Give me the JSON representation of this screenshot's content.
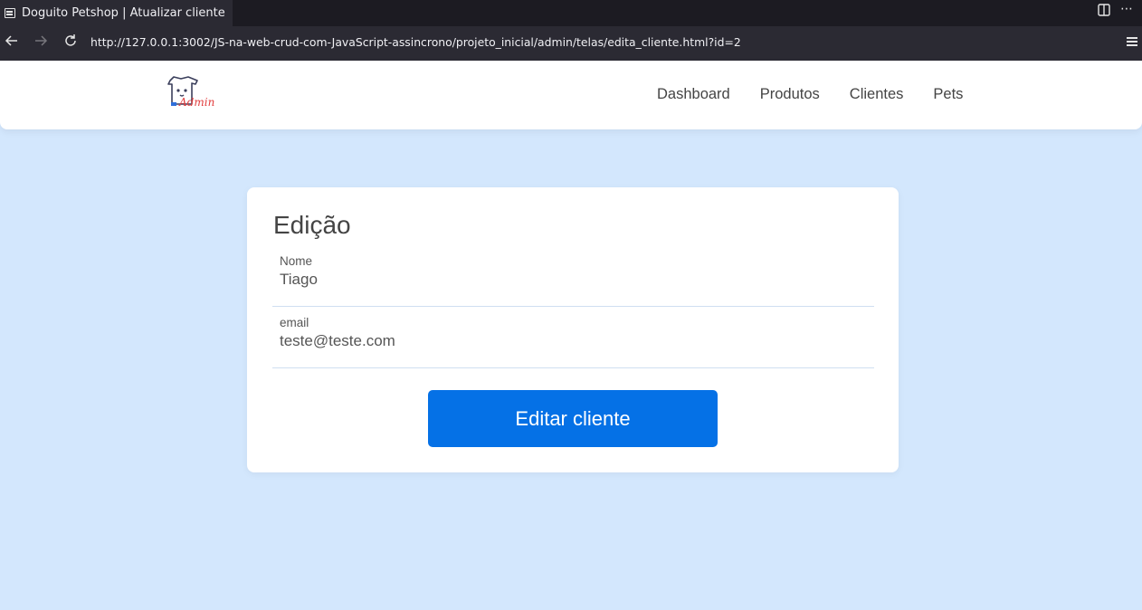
{
  "browser": {
    "tab_title": "Doguito Petshop | Atualizar cliente",
    "url": "http://127.0.0.1:3002/JS-na-web-crud-com-JavaScript-assincrono/projeto_inicial/admin/telas/edita_cliente.html?id=2",
    "icons": {
      "tab": "page-icon",
      "back": "arrow-left-icon",
      "forward": "arrow-right-icon",
      "reload": "reload-icon",
      "sidebar": "sidebar-icon",
      "more": "ellipsis-icon",
      "menu": "hamburger-icon"
    }
  },
  "header": {
    "logo_text": "Admin",
    "nav": [
      "Dashboard",
      "Produtos",
      "Clientes",
      "Pets"
    ]
  },
  "form": {
    "title": "Edição",
    "fields": [
      {
        "label": "Nome",
        "value": "Tiago"
      },
      {
        "label": "email",
        "value": "teste@teste.com"
      }
    ],
    "submit_label": "Editar cliente"
  },
  "colors": {
    "page_background": "#d3e7fd",
    "accent": "#0571e6",
    "logo_accent": "#e23d3d"
  }
}
